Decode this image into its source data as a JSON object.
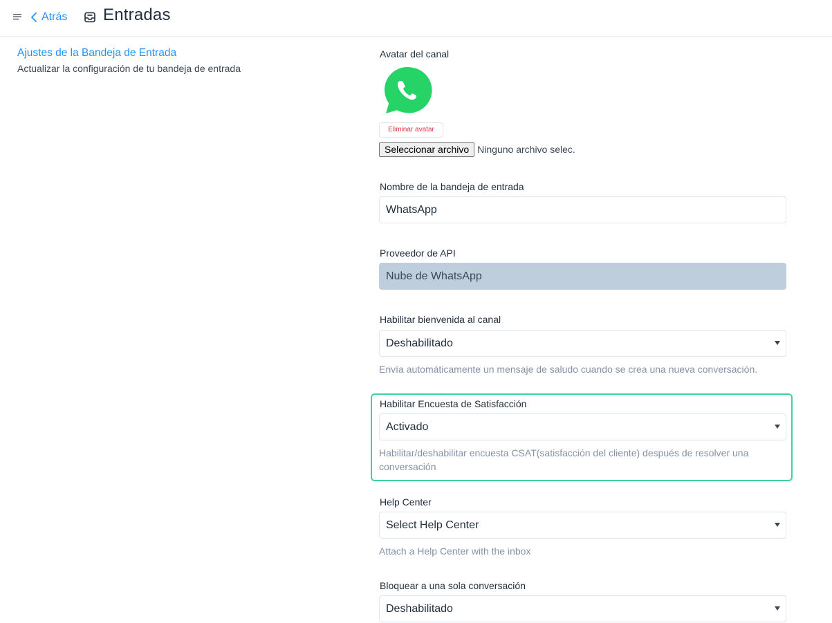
{
  "header": {
    "back_label": "Atrás",
    "title": "Entradas"
  },
  "section": {
    "title": "Ajustes de la Bandeja de Entrada",
    "subtitle": "Actualizar la configuración de tu bandeja de entrada"
  },
  "avatar": {
    "label": "Avatar del canal",
    "icon": "whatsapp-logo",
    "remove_label": "Eliminar avatar",
    "file_button": "Seleccionar archivo",
    "file_status": "Ninguno archivo selec."
  },
  "inbox_name": {
    "label": "Nombre de la bandeja de entrada",
    "value": "WhatsApp"
  },
  "api_provider": {
    "label": "Proveedor de API",
    "value": "Nube de WhatsApp"
  },
  "greeting": {
    "label": "Habilitar bienvenida al canal",
    "value": "Deshabilitado",
    "help": "Envía automáticamente un mensaje de saludo cuando se crea una nueva conversación."
  },
  "csat": {
    "label": "Habilitar Encuesta de Satisfacción",
    "value": "Activado",
    "help_line1": "Habilitar/deshabilitar encuesta CSAT(satisfacción del cliente) después de resolver una",
    "help_line2": "conversación"
  },
  "help_center": {
    "label": "Help Center",
    "value": "Select Help Center",
    "help": "Attach a Help Center with the inbox"
  },
  "lock_single": {
    "label": "Bloquear a una sola conversación",
    "value": "Deshabilitado"
  },
  "colors": {
    "accent": "#1f93ff",
    "highlight": "#3bd1a0",
    "danger": "#e0383e",
    "disabled_bg": "#bfcedc"
  }
}
